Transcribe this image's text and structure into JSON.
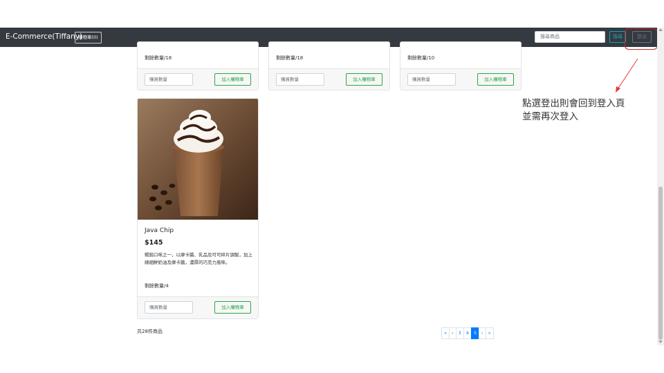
{
  "navbar": {
    "brand": "E-Commerce(Tiffany)",
    "cart_label": "購物車(0)",
    "search_placeholder": "搜尋商品",
    "search_button": "搜尋",
    "logout_button": "登出"
  },
  "products_top": [
    {
      "stock": "剩餘數量/18",
      "qty_placeholder": "購買數量",
      "add_label": "加入購物車"
    },
    {
      "stock": "剩餘數量/18",
      "qty_placeholder": "購買數量",
      "add_label": "加入購物車"
    },
    {
      "stock": "剩餘數量/10",
      "qty_placeholder": "購買數量",
      "add_label": "加入購物車"
    }
  ],
  "product_main": {
    "name": "Java Chip",
    "price": "$145",
    "description": "暢銷口味之一，以摩卡醬、乳品及可可碎片調製，加上綿細鮮奶油及摩卡醬，濃厚的巧克力風味。",
    "stock": "剩餘數量/4",
    "qty_placeholder": "購買數量",
    "add_label": "加入購物車"
  },
  "footer": {
    "total": "共28件商品"
  },
  "pagination": {
    "items": [
      "«",
      "‹",
      "3",
      "4",
      "5",
      "›",
      "»"
    ],
    "current": "5"
  },
  "annotation": {
    "line1": "點選登出則會回到登入頁",
    "line2": "並需再次登入"
  },
  "colors": {
    "navbar": "#343a40",
    "highlight": "#c62828",
    "primary": "#007bff",
    "success": "#28a745",
    "info": "#17a2b8"
  }
}
